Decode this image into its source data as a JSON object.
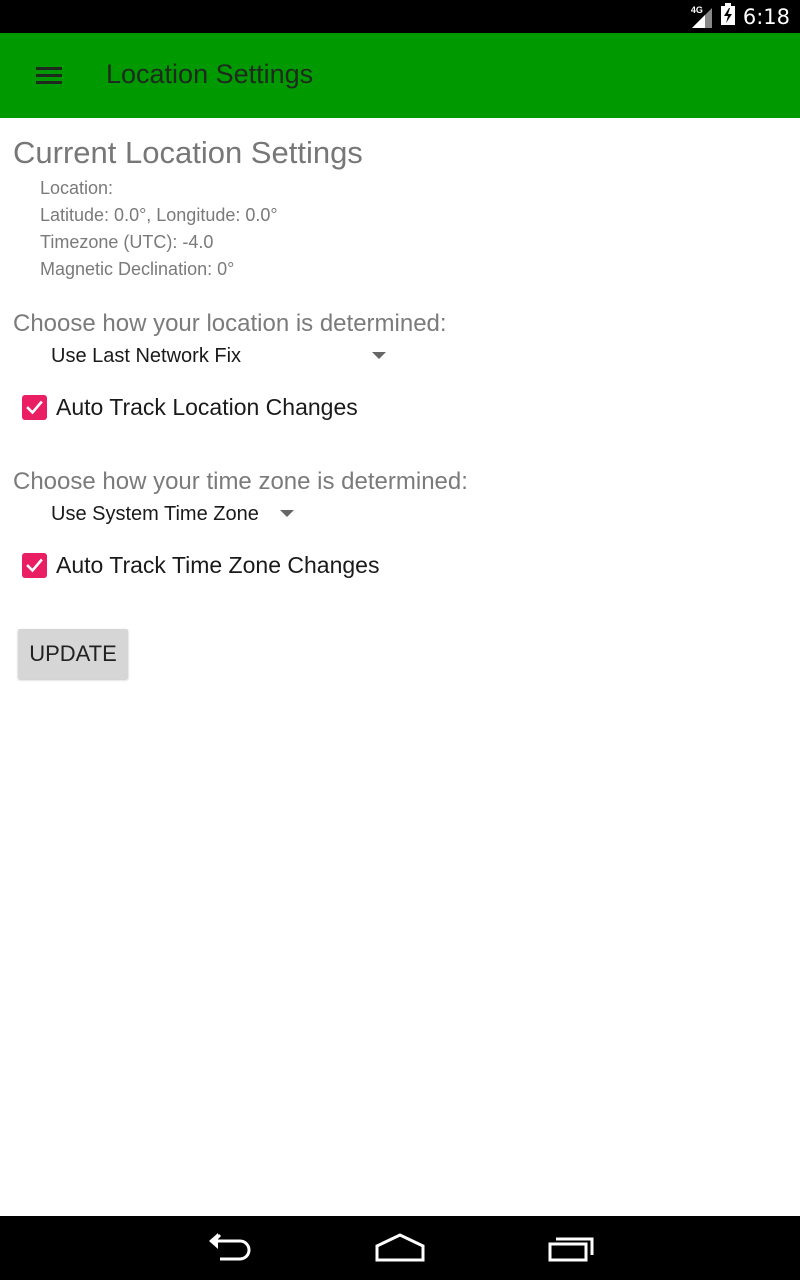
{
  "status_bar": {
    "network": "4G",
    "time": "6:18",
    "icons": [
      "signal-icon",
      "battery-icon"
    ]
  },
  "app_bar": {
    "title": "Location Settings",
    "menu_icon": "menu-icon",
    "background": "#009900"
  },
  "current": {
    "title": "Current Location Settings",
    "lines": [
      "Location:",
      "Latitude: 0.0°, Longitude: 0.0°",
      "Timezone (UTC): -4.0",
      "Magnetic Declination: 0°"
    ]
  },
  "location": {
    "prompt": "Choose how your location is determined:",
    "selected": "Use Last Network Fix",
    "auto_track_label": "Auto Track Location Changes",
    "auto_track_checked": true
  },
  "timezone": {
    "prompt": "Choose how your time zone is determined:",
    "selected": "Use System Time Zone",
    "auto_track_label": "Auto Track Time Zone Changes",
    "auto_track_checked": true
  },
  "update_button": "UPDATE",
  "nav_bar": {
    "icons": [
      "back-icon",
      "home-icon",
      "recents-icon"
    ]
  },
  "colors": {
    "accent": "#e91e63",
    "app_bar": "#009900"
  }
}
